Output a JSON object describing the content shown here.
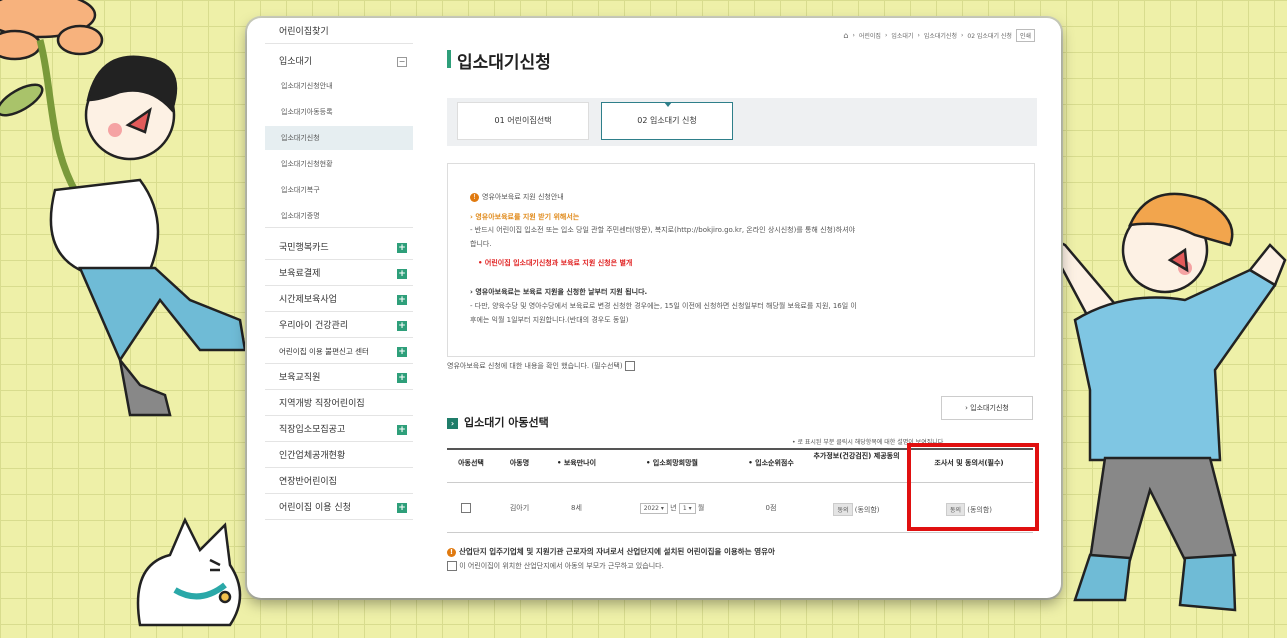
{
  "sidebar": {
    "items": [
      {
        "label": "어린이집찾기"
      },
      {
        "label": "입소대기"
      },
      {
        "label": "입소대기신청안내"
      },
      {
        "label": "입소대기아동등록"
      },
      {
        "label": "입소대기신청"
      },
      {
        "label": "입소대기신청현황"
      },
      {
        "label": "입소대기복구"
      },
      {
        "label": "입소대기증명"
      },
      {
        "label": "국민행복카드"
      },
      {
        "label": "보육료결제"
      },
      {
        "label": "시간제보육사업"
      },
      {
        "label": "우리아이 건강관리"
      },
      {
        "label": "어린이집 이용 불편신고 센터"
      },
      {
        "label": "보육교직원"
      },
      {
        "label": "지역개방 직장어린이집"
      },
      {
        "label": "직장입소모집공고"
      },
      {
        "label": "인간업체공개현황"
      },
      {
        "label": "연장반어린이집"
      },
      {
        "label": "어린이집 이용 신청"
      }
    ]
  },
  "breadcrumb": {
    "items": [
      "어린이집",
      "입소대기",
      "입소대기신청",
      "02 입소대기 신청"
    ],
    "print": "인쇄"
  },
  "page_title": "입소대기신청",
  "steps": [
    {
      "label": "01 어린이집선택"
    },
    {
      "label": "02 입소대기 신청"
    }
  ],
  "notice": {
    "title": "영유아보육료 지원 신청안내",
    "h1": "› 영유아보육료를 지원 받기 위해서는",
    "p1a": "- 반드시 어린이집 입소전 또는 입소 당일 관할 주민센터(방문), 복지로(http://bokjiro.go.kr, 온라인 상시신청)를 통해 신청)하셔야",
    "p1b": "합니다.",
    "warn": "• 어린이집 입소대기신청과 보육료 지원 신청은 별개",
    "h2": "› 영유아보육료는 보육료 지원을 신청한 날부터 지원 됩니다.",
    "p2a": "- 다만, 양육수당 및 영아수당에서 보육료로 변경 신청한 경우에는, 15일 이전에 신청하면 신청일부터 해당월 보육료를 지원, 16일 이",
    "p2b": "후에는 익월 1일부터 지원합니다.(반대의 경우도 동일)"
  },
  "confirm_text": "영유아보육료 신청에 대한 내용을 확인 했습니다. (필수선택)",
  "apply_button": "› 입소대기신청",
  "section_title": "입소대기 아동선택",
  "table_note": "• 로 표시된 부분 클릭시 해당항목에 대한 설명이 보여집니다.",
  "table": {
    "headers": [
      "아동선택",
      "아동명",
      "• 보육만나이",
      "• 입소희망희망월",
      "• 입소순위점수",
      "추가정보(건강검진) 제공동의",
      "조사서 및 동의서(필수)"
    ],
    "row": {
      "name": "김아기",
      "age": "8세",
      "year": "2022",
      "year_unit": "년",
      "month": "1",
      "month_unit": "월",
      "score": "0점",
      "agree1": "동의",
      "agree1_status": "(동의함)",
      "agree2": "동의",
      "agree2_status": "(동의함)"
    }
  },
  "industrial": {
    "title": "산업단지 입주기업체 및 지원기관 근로자의 자녀로서 산업단지에 설치된 어린이집을 이용하는 영유아",
    "check": "이 어린이집이 위치한 산업단지에서 아동의 부모가 근무하고 있습니다."
  },
  "colors": {
    "accent": "#2e9f7a",
    "highlight": "#e01010",
    "warning": "#e08a1a",
    "background": "#eef0a8"
  }
}
